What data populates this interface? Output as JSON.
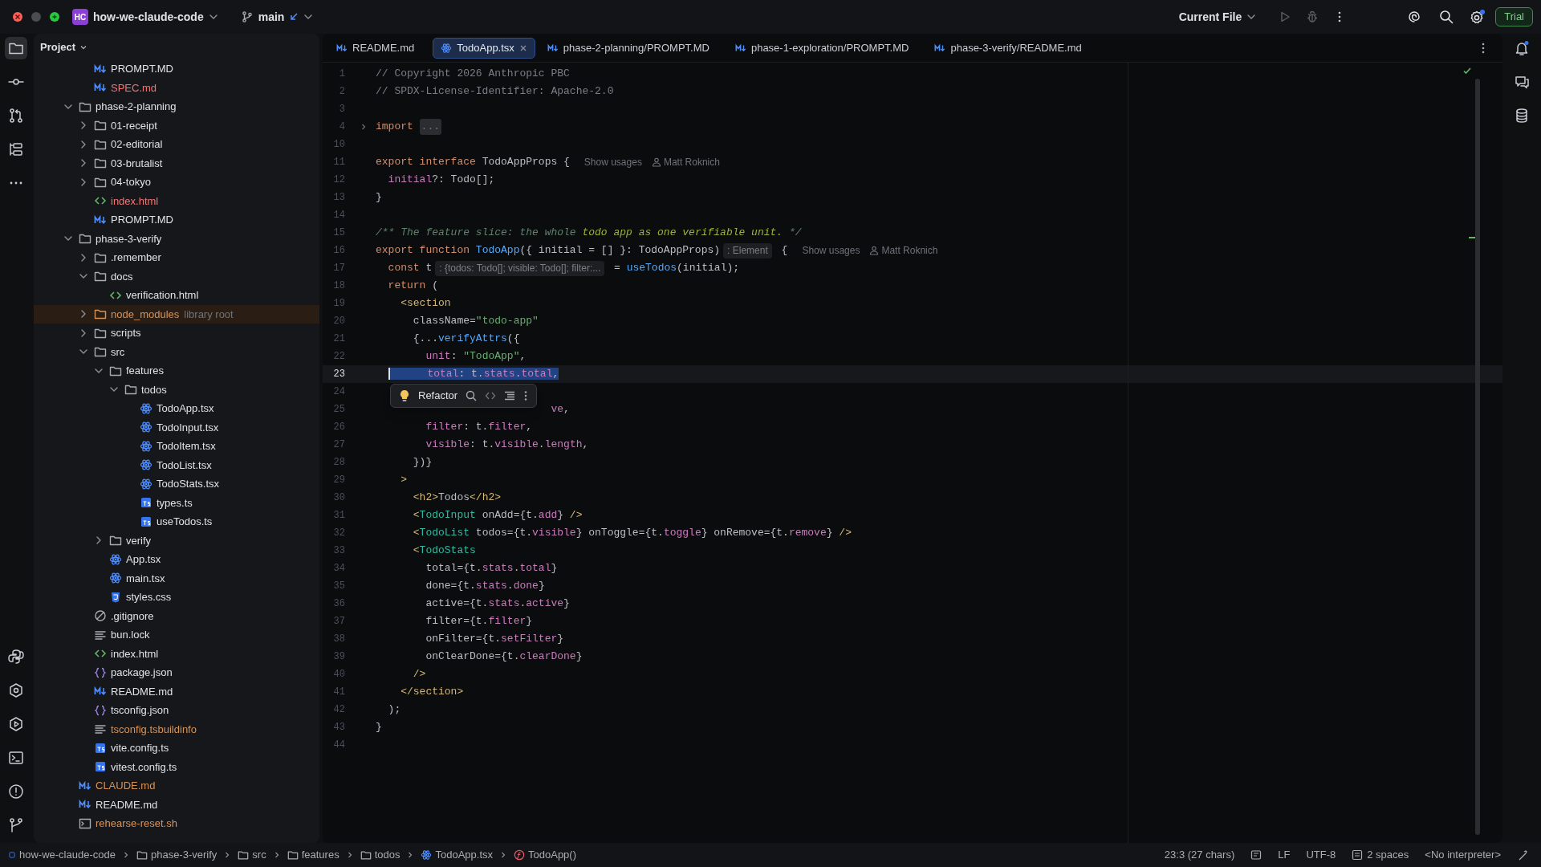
{
  "titlebar": {
    "project_badge": "HC",
    "project": "how-we-claude-code",
    "branch": "main",
    "run_config": "Current File",
    "trial": "Trial"
  },
  "project_panel": {
    "title": "Project",
    "tree": [
      {
        "children": [
          {
            "label": "PROMPT.MD",
            "kind": "md",
            "color": "#dfe1e5"
          },
          {
            "label": "SPEC.md",
            "kind": "md",
            "color": "#f27575"
          }
        ]
      },
      {
        "label": "phase-2-planning",
        "kind": "folder",
        "color": "#dfe1e5",
        "expanded": true,
        "children": [
          {
            "label": "01-receipt",
            "kind": "folder",
            "color": "#dfe1e5",
            "expanded": false
          },
          {
            "label": "02-editorial",
            "kind": "folder",
            "color": "#dfe1e5",
            "expanded": false
          },
          {
            "label": "03-brutalist",
            "kind": "folder",
            "color": "#dfe1e5",
            "expanded": false
          },
          {
            "label": "04-tokyo",
            "kind": "folder",
            "color": "#dfe1e5",
            "expanded": false
          },
          {
            "label": "index.html",
            "kind": "html",
            "color": "#f27575"
          },
          {
            "label": "PROMPT.MD",
            "kind": "md",
            "color": "#dfe1e5"
          }
        ]
      },
      {
        "label": "phase-3-verify",
        "kind": "folder",
        "color": "#dfe1e5",
        "expanded": true,
        "children": [
          {
            "label": ".remember",
            "kind": "folder",
            "color": "#dfe1e5",
            "expanded": false
          },
          {
            "label": "docs",
            "kind": "folder",
            "color": "#dfe1e5",
            "expanded": true,
            "children": [
              {
                "label": "verification.html",
                "kind": "html",
                "color": "#dfe1e5"
              }
            ]
          },
          {
            "label": "node_modules",
            "kind": "folder",
            "color": "#d5935a",
            "expanded": false,
            "note": "library root"
          },
          {
            "label": "scripts",
            "kind": "folder",
            "color": "#dfe1e5",
            "expanded": false
          },
          {
            "label": "src",
            "kind": "folder",
            "color": "#dfe1e5",
            "expanded": true,
            "children": [
              {
                "label": "features",
                "kind": "folder",
                "color": "#dfe1e5",
                "expanded": true,
                "children": [
                  {
                    "label": "todos",
                    "kind": "folder",
                    "color": "#dfe1e5",
                    "expanded": true,
                    "children": [
                      {
                        "label": "TodoApp.tsx",
                        "kind": "tsx",
                        "color": "#dfe1e5"
                      },
                      {
                        "label": "TodoInput.tsx",
                        "kind": "tsx",
                        "color": "#dfe1e5"
                      },
                      {
                        "label": "TodoItem.tsx",
                        "kind": "tsx",
                        "color": "#dfe1e5"
                      },
                      {
                        "label": "TodoList.tsx",
                        "kind": "tsx",
                        "color": "#dfe1e5"
                      },
                      {
                        "label": "TodoStats.tsx",
                        "kind": "tsx",
                        "color": "#dfe1e5"
                      },
                      {
                        "label": "types.ts",
                        "kind": "ts",
                        "color": "#dfe1e5"
                      },
                      {
                        "label": "useTodos.ts",
                        "kind": "ts",
                        "color": "#dfe1e5"
                      }
                    ]
                  }
                ]
              },
              {
                "label": "verify",
                "kind": "folder",
                "color": "#dfe1e5",
                "expanded": false
              },
              {
                "label": "App.tsx",
                "kind": "tsx",
                "color": "#dfe1e5"
              },
              {
                "label": "main.tsx",
                "kind": "tsx",
                "color": "#dfe1e5"
              },
              {
                "label": "styles.css",
                "kind": "css",
                "color": "#dfe1e5"
              }
            ]
          },
          {
            "label": ".gitignore",
            "kind": "gitignore",
            "color": "#dfe1e5"
          },
          {
            "label": "bun.lock",
            "kind": "text",
            "color": "#dfe1e5"
          },
          {
            "label": "index.html",
            "kind": "html",
            "color": "#dfe1e5"
          },
          {
            "label": "package.json",
            "kind": "json",
            "color": "#dfe1e5"
          },
          {
            "label": "README.md",
            "kind": "md",
            "color": "#dfe1e5"
          },
          {
            "label": "tsconfig.json",
            "kind": "json",
            "color": "#dfe1e5"
          },
          {
            "label": "tsconfig.tsbuildinfo",
            "kind": "text",
            "color": "#d5935a"
          },
          {
            "label": "vite.config.ts",
            "kind": "ts",
            "color": "#dfe1e5"
          },
          {
            "label": "vitest.config.ts",
            "kind": "ts",
            "color": "#dfe1e5"
          }
        ]
      },
      {
        "label": "CLAUDE.md",
        "kind": "md",
        "color": "#d5935a"
      },
      {
        "label": "README.md",
        "kind": "md",
        "color": "#dfe1e5"
      },
      {
        "label": "rehearse-reset.sh",
        "kind": "sh",
        "color": "#d5935a"
      }
    ]
  },
  "tabs": [
    {
      "label": "README.md",
      "kind": "md",
      "selected": false
    },
    {
      "label": "TodoApp.tsx",
      "kind": "tsx",
      "selected": true
    },
    {
      "label": "phase-2-planning/PROMPT.MD",
      "kind": "md",
      "selected": false
    },
    {
      "label": "phase-1-exploration/PROMPT.MD",
      "kind": "md",
      "selected": false
    },
    {
      "label": "phase-3-verify/README.md",
      "kind": "md",
      "selected": false
    }
  ],
  "editor": {
    "lines": [
      {
        "number": "1",
        "tokens": [
          {
            "kind": "comment",
            "text": "// Copyright 2026 Anthropic PBC"
          }
        ]
      },
      {
        "number": "2",
        "tokens": [
          {
            "kind": "comment",
            "text": "// SPDX-License-Identifier: Apache-2.0"
          }
        ]
      },
      {
        "number": "3"
      },
      {
        "number": "4",
        "tokens": [
          {
            "kind": "keyword",
            "text": "import "
          },
          {
            "kind": "folded",
            "text": "..."
          }
        ]
      },
      {
        "number": "10"
      },
      {
        "number": "11",
        "tokens": [
          {
            "kind": "keyword",
            "text": "export interface "
          },
          {
            "kind": "plain",
            "text": "TodoAppProps {"
          },
          {
            "kind": "usages",
            "text": "Show usages"
          },
          {
            "kind": "author",
            "text": "Matt Roknich"
          }
        ]
      },
      {
        "number": "12",
        "tokens": [
          {
            "kind": "prop",
            "text": "  initial"
          },
          {
            "kind": "plain",
            "text": "?: Todo[];"
          }
        ]
      },
      {
        "number": "13",
        "tokens": [
          {
            "kind": "plain",
            "text": "}"
          }
        ]
      },
      {
        "number": "14"
      },
      {
        "number": "15",
        "tokens": [
          {
            "kind": "doc",
            "text": "/** The feature slice: the whole "
          },
          {
            "kind": "docmark",
            "text": "todo app as one verifiable unit."
          },
          {
            "kind": "doc",
            "text": " */"
          }
        ]
      },
      {
        "number": "16",
        "tokens": [
          {
            "kind": "keyword",
            "text": "export function "
          },
          {
            "kind": "fn",
            "text": "TodoApp"
          },
          {
            "kind": "plain",
            "text": "({ initial = [] }: TodoAppProps)"
          },
          {
            "kind": "inlay",
            "text": ": Element"
          },
          {
            "kind": "plain",
            "text": " {"
          },
          {
            "kind": "usages",
            "text": "Show usages"
          },
          {
            "kind": "author",
            "text": "Matt Roknich"
          }
        ]
      },
      {
        "number": "17",
        "tokens": [
          {
            "kind": "keyword",
            "text": "  const"
          },
          {
            "kind": "plain",
            "text": " t"
          },
          {
            "kind": "inlay",
            "text": ": {todos: Todo[]; visible: Todo[]; filter:..."
          },
          {
            "kind": "plain",
            "text": " = "
          },
          {
            "kind": "fn",
            "text": "useTodos"
          },
          {
            "kind": "plain",
            "text": "(initial);"
          }
        ]
      },
      {
        "number": "18",
        "tokens": [
          {
            "kind": "keyword",
            "text": "  return"
          },
          {
            "kind": "plain",
            "text": " ("
          }
        ]
      },
      {
        "number": "19",
        "tokens": [
          {
            "kind": "tag",
            "text": "    <section"
          }
        ]
      },
      {
        "number": "20",
        "tokens": [
          {
            "kind": "plain",
            "text": "      className="
          },
          {
            "kind": "string",
            "text": "\"todo-app\""
          }
        ]
      },
      {
        "number": "21",
        "tokens": [
          {
            "kind": "plain",
            "text": "      {..."
          },
          {
            "kind": "fn",
            "text": "verifyAttrs"
          },
          {
            "kind": "plain",
            "text": "({"
          }
        ]
      },
      {
        "number": "22",
        "tokens": [
          {
            "kind": "prop",
            "text": "        unit"
          },
          {
            "kind": "plain",
            "text": ": "
          },
          {
            "kind": "string",
            "text": "\"TodoApp\""
          },
          {
            "kind": "plain",
            "text": ","
          }
        ]
      },
      {
        "number": "23",
        "selected_tokens": [
          {
            "kind": "prop",
            "text": "      total"
          },
          {
            "kind": "plain",
            "text": ": t."
          },
          {
            "kind": "prop",
            "text": "stats"
          },
          {
            "kind": "plain",
            "text": "."
          },
          {
            "kind": "prop",
            "text": "total"
          },
          {
            "kind": "plain",
            "text": ","
          }
        ]
      },
      {
        "number": "24"
      },
      {
        "number": "25",
        "tokens": [
          {
            "kind": "prop",
            "text": "                            ve"
          },
          {
            "kind": "plain",
            "text": ","
          }
        ]
      },
      {
        "number": "26",
        "tokens": [
          {
            "kind": "prop",
            "text": "        filter"
          },
          {
            "kind": "plain",
            "text": ": t."
          },
          {
            "kind": "prop",
            "text": "filter"
          },
          {
            "kind": "plain",
            "text": ","
          }
        ]
      },
      {
        "number": "27",
        "tokens": [
          {
            "kind": "prop",
            "text": "        visible"
          },
          {
            "kind": "plain",
            "text": ": t."
          },
          {
            "kind": "prop",
            "text": "visible"
          },
          {
            "kind": "plain",
            "text": "."
          },
          {
            "kind": "prop",
            "text": "length"
          },
          {
            "kind": "plain",
            "text": ","
          }
        ]
      },
      {
        "number": "28",
        "tokens": [
          {
            "kind": "plain",
            "text": "      })}"
          }
        ]
      },
      {
        "number": "29",
        "tokens": [
          {
            "kind": "tag",
            "text": "    >"
          }
        ]
      },
      {
        "number": "30",
        "tokens": [
          {
            "kind": "tag",
            "text": "      <h2>"
          },
          {
            "kind": "plain",
            "text": "Todos"
          },
          {
            "kind": "tag",
            "text": "</h2>"
          }
        ]
      },
      {
        "number": "31",
        "tokens": [
          {
            "kind": "tag",
            "text": "      <"
          },
          {
            "kind": "component",
            "text": "TodoInput"
          },
          {
            "kind": "plain",
            "text": " onAdd={t."
          },
          {
            "kind": "prop",
            "text": "add"
          },
          {
            "kind": "plain",
            "text": "} "
          },
          {
            "kind": "tag",
            "text": "/>"
          }
        ]
      },
      {
        "number": "32",
        "tokens": [
          {
            "kind": "tag",
            "text": "      <"
          },
          {
            "kind": "component",
            "text": "TodoList"
          },
          {
            "kind": "plain",
            "text": " todos={t."
          },
          {
            "kind": "prop",
            "text": "visible"
          },
          {
            "kind": "plain",
            "text": "} onToggle={t."
          },
          {
            "kind": "prop",
            "text": "toggle"
          },
          {
            "kind": "plain",
            "text": "} onRemove={t."
          },
          {
            "kind": "prop",
            "text": "remove"
          },
          {
            "kind": "plain",
            "text": "} "
          },
          {
            "kind": "tag",
            "text": "/>"
          }
        ]
      },
      {
        "number": "33",
        "tokens": [
          {
            "kind": "tag",
            "text": "      <"
          },
          {
            "kind": "component",
            "text": "TodoStats"
          }
        ]
      },
      {
        "number": "34",
        "tokens": [
          {
            "kind": "plain",
            "text": "        total={t."
          },
          {
            "kind": "prop",
            "text": "stats"
          },
          {
            "kind": "plain",
            "text": "."
          },
          {
            "kind": "prop",
            "text": "total"
          },
          {
            "kind": "plain",
            "text": "}"
          }
        ]
      },
      {
        "number": "35",
        "tokens": [
          {
            "kind": "plain",
            "text": "        done={t."
          },
          {
            "kind": "prop",
            "text": "stats"
          },
          {
            "kind": "plain",
            "text": "."
          },
          {
            "kind": "prop",
            "text": "done"
          },
          {
            "kind": "plain",
            "text": "}"
          }
        ]
      },
      {
        "number": "36",
        "tokens": [
          {
            "kind": "plain",
            "text": "        active={t."
          },
          {
            "kind": "prop",
            "text": "stats"
          },
          {
            "kind": "plain",
            "text": "."
          },
          {
            "kind": "prop",
            "text": "active"
          },
          {
            "kind": "plain",
            "text": "}"
          }
        ]
      },
      {
        "number": "37",
        "tokens": [
          {
            "kind": "plain",
            "text": "        filter={t."
          },
          {
            "kind": "prop",
            "text": "filter"
          },
          {
            "kind": "plain",
            "text": "}"
          }
        ]
      },
      {
        "number": "38",
        "tokens": [
          {
            "kind": "plain",
            "text": "        onFilter={t."
          },
          {
            "kind": "prop",
            "text": "setFilter"
          },
          {
            "kind": "plain",
            "text": "}"
          }
        ]
      },
      {
        "number": "39",
        "tokens": [
          {
            "kind": "plain",
            "text": "        onClearDone={t."
          },
          {
            "kind": "prop",
            "text": "clearDone"
          },
          {
            "kind": "plain",
            "text": "}"
          }
        ]
      },
      {
        "number": "40",
        "tokens": [
          {
            "kind": "tag",
            "text": "      />"
          }
        ]
      },
      {
        "number": "41",
        "tokens": [
          {
            "kind": "tag",
            "text": "    </section>"
          }
        ]
      },
      {
        "number": "42",
        "tokens": [
          {
            "kind": "plain",
            "text": "  );"
          }
        ]
      },
      {
        "number": "43",
        "tokens": [
          {
            "kind": "plain",
            "text": "}"
          }
        ]
      },
      {
        "number": "44"
      }
    ],
    "popup": {
      "label": "Refactor"
    }
  },
  "status_bar": {
    "breadcrumbs": [
      {
        "label": "how-we-claude-code",
        "kind": "project"
      },
      {
        "label": "phase-3-verify",
        "kind": "folder"
      },
      {
        "label": "src",
        "kind": "folder"
      },
      {
        "label": "features",
        "kind": "folder"
      },
      {
        "label": "todos",
        "kind": "folder"
      },
      {
        "label": "TodoApp.tsx",
        "kind": "tsx"
      },
      {
        "label": "TodoApp()",
        "kind": "function"
      }
    ],
    "position": "23:3 (27 chars)",
    "line_separator": "LF",
    "encoding": "UTF-8",
    "indent": "2 spaces",
    "interpreter": "<No interpreter>"
  }
}
